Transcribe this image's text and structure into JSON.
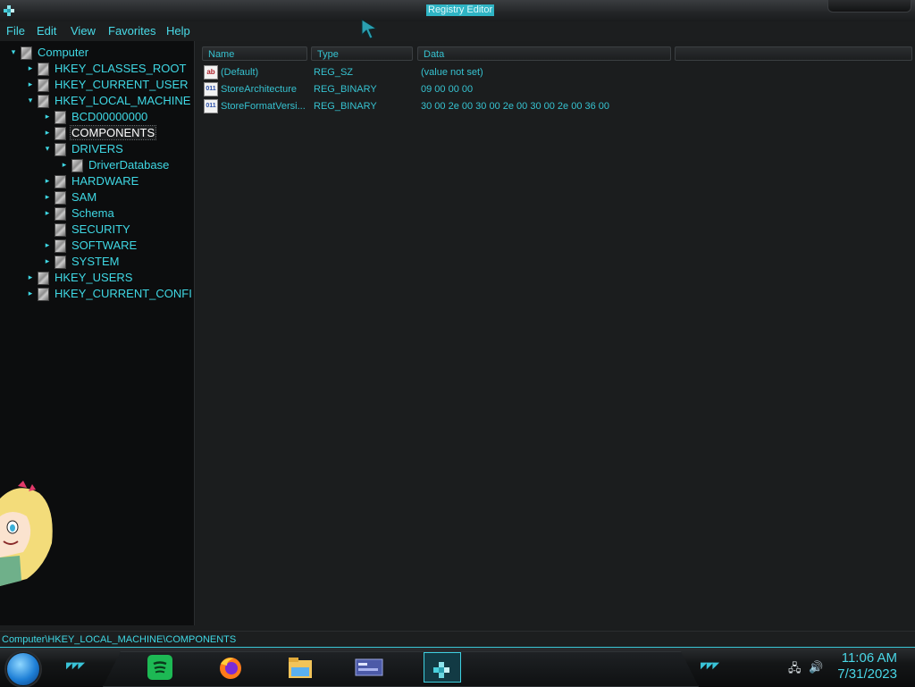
{
  "window": {
    "title": "Registry Editor"
  },
  "menu": [
    "File",
    "Edit",
    "View",
    "Favorites",
    "Help"
  ],
  "tree": [
    {
      "label": "Computer",
      "indent": 0,
      "expander": "open"
    },
    {
      "label": "HKEY_CLASSES_ROOT",
      "indent": 1,
      "expander": "closed"
    },
    {
      "label": "HKEY_CURRENT_USER",
      "indent": 1,
      "expander": "closed"
    },
    {
      "label": "HKEY_LOCAL_MACHINE",
      "indent": 1,
      "expander": "open"
    },
    {
      "label": "BCD00000000",
      "indent": 2,
      "expander": "closed"
    },
    {
      "label": "COMPONENTS",
      "indent": 2,
      "expander": "closed",
      "selected": true
    },
    {
      "label": "DRIVERS",
      "indent": 2,
      "expander": "open"
    },
    {
      "label": "DriverDatabase",
      "indent": 3,
      "expander": "closed"
    },
    {
      "label": "HARDWARE",
      "indent": 2,
      "expander": "closed"
    },
    {
      "label": "SAM",
      "indent": 2,
      "expander": "closed"
    },
    {
      "label": "Schema",
      "indent": 2,
      "expander": "closed"
    },
    {
      "label": "SECURITY",
      "indent": 2,
      "expander": "none"
    },
    {
      "label": "SOFTWARE",
      "indent": 2,
      "expander": "closed"
    },
    {
      "label": "SYSTEM",
      "indent": 2,
      "expander": "closed"
    },
    {
      "label": "HKEY_USERS",
      "indent": 1,
      "expander": "closed"
    },
    {
      "label": "HKEY_CURRENT_CONFI",
      "indent": 1,
      "expander": "closed"
    }
  ],
  "columns": {
    "name": "Name",
    "type": "Type",
    "data": "Data"
  },
  "values": [
    {
      "icon": "string-value-icon",
      "icon_text": "ab",
      "name": "(Default)",
      "type": "REG_SZ",
      "data": "(value not set)"
    },
    {
      "icon": "binary-value-icon",
      "icon_text": "011",
      "name": "StoreArchitecture",
      "type": "REG_BINARY",
      "data": "09 00 00 00"
    },
    {
      "icon": "binary-value-icon",
      "icon_text": "011",
      "name": "StoreFormatVersi...",
      "type": "REG_BINARY",
      "data": "30 00 2e 00 30 00 2e 00 30 00 2e 00 36 00"
    }
  ],
  "status": {
    "path": "Computer\\HKEY_LOCAL_MACHINE\\COMPONENTS"
  },
  "taskbar": {
    "apps": [
      "spotify-icon",
      "firefox-icon",
      "file-explorer-icon",
      "control-panel-icon",
      "registry-editor-icon"
    ],
    "clock_time": "11:06 AM",
    "clock_date": "7/31/2023"
  },
  "colors": {
    "accent": "#3fd8e4",
    "background": "#1b1d1e",
    "tree_bg": "#0c0d0e"
  }
}
